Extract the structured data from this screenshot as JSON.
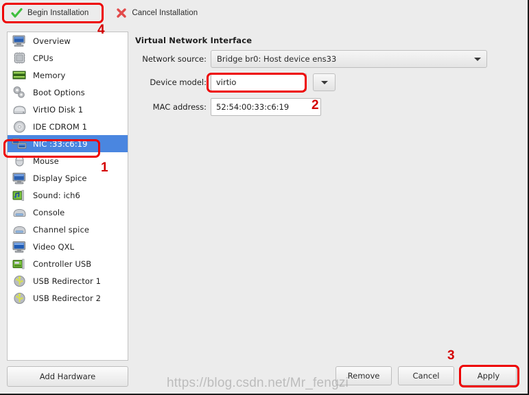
{
  "toolbar": {
    "begin_label": "Begin Installation",
    "begin_icon": "green-check-icon",
    "cancel_label": "Cancel Installation",
    "cancel_icon": "red-x-icon"
  },
  "sidebar": {
    "items": [
      {
        "label": "Overview",
        "icon": "monitor-icon",
        "selected": false
      },
      {
        "label": "CPUs",
        "icon": "cpu-chip-icon",
        "selected": false
      },
      {
        "label": "Memory",
        "icon": "memory-ram-icon",
        "selected": false
      },
      {
        "label": "Boot Options",
        "icon": "gears-icon",
        "selected": false
      },
      {
        "label": "VirtIO Disk 1",
        "icon": "harddisk-icon",
        "selected": false
      },
      {
        "label": "IDE CDROM 1",
        "icon": "cdrom-disc-icon",
        "selected": false
      },
      {
        "label": "NIC :33:c6:19",
        "icon": "network-card-icon",
        "selected": true
      },
      {
        "label": "Mouse",
        "icon": "mouse-icon",
        "selected": false
      },
      {
        "label": "Display Spice",
        "icon": "display-icon",
        "selected": false
      },
      {
        "label": "Sound: ich6",
        "icon": "sound-card-icon",
        "selected": false
      },
      {
        "label": "Console",
        "icon": "console-icon",
        "selected": false
      },
      {
        "label": "Channel spice",
        "icon": "channel-icon",
        "selected": false
      },
      {
        "label": "Video QXL",
        "icon": "video-icon",
        "selected": false
      },
      {
        "label": "Controller USB",
        "icon": "usb-controller-icon",
        "selected": false
      },
      {
        "label": "USB Redirector 1",
        "icon": "usb-plug-icon",
        "selected": false
      },
      {
        "label": "USB Redirector 2",
        "icon": "usb-plug-icon",
        "selected": false
      }
    ],
    "add_hardware_label": "Add Hardware"
  },
  "main": {
    "section_title": "Virtual Network Interface",
    "fields": {
      "network_source": {
        "label": "Network source:",
        "value": "Bridge br0: Host device ens33"
      },
      "device_model": {
        "label": "Device model:",
        "value": "virtio"
      },
      "mac_address": {
        "label": "MAC address:",
        "value": "52:54:00:33:c6:19"
      }
    }
  },
  "footer": {
    "remove_label": "Remove",
    "cancel_label": "Cancel",
    "apply_label": "Apply"
  },
  "annotations": {
    "markers": [
      "1",
      "2",
      "3",
      "4"
    ]
  },
  "watermark": {
    "text": "https://blog.csdn.net/Mr_fengzi"
  },
  "colors": {
    "selection_blue": "#4a86e0",
    "annotation_red": "#ee0000",
    "window_bg": "#ececec"
  }
}
